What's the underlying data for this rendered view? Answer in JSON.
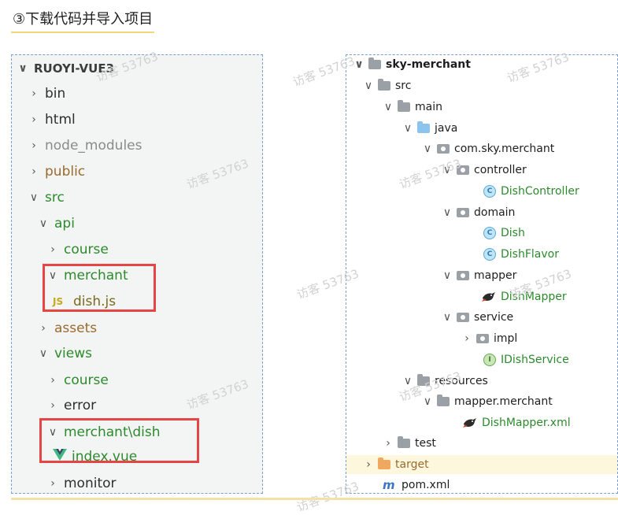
{
  "heading": "③下载代码并导入项目",
  "watermark": "访客 53763",
  "left_tree": {
    "root": "RUOYI-VUE3",
    "items": [
      "bin",
      "html",
      "node_modules",
      "public",
      "src",
      "api",
      "course",
      "merchant",
      "dish.js",
      "assets",
      "views",
      "course",
      "error",
      "merchant\\dish",
      "index.vue",
      "monitor"
    ]
  },
  "right_tree": {
    "root": "sky-merchant",
    "items": [
      "src",
      "main",
      "java",
      "com.sky.merchant",
      "controller",
      "DishController",
      "domain",
      "Dish",
      "DishFlavor",
      "mapper",
      "DishMapper",
      "service",
      "impl",
      "IDishService",
      "resources",
      "mapper.merchant",
      "DishMapper.xml",
      "test",
      "target",
      "pom.xml"
    ]
  },
  "icons": {
    "js_label": "JS",
    "class_letter": "C",
    "interface_letter": "I",
    "pom_letter": "m"
  },
  "colors": {
    "highlight_box": "#e64545",
    "green_text": "#2d8a2d",
    "left_panel_bg": "#f3f4f4"
  }
}
